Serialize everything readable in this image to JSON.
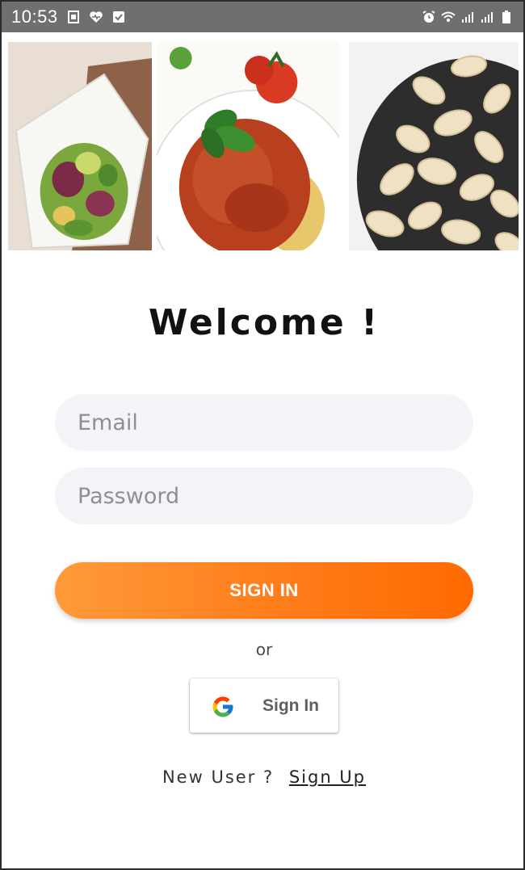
{
  "status_bar": {
    "time": "10:53",
    "icons": [
      "sim-card-icon",
      "heart-icon",
      "checkbox-icon",
      "alarm-icon",
      "wifi-icon",
      "signal-icon",
      "signal-icon",
      "battery-icon"
    ]
  },
  "banner": {
    "images": [
      "salad-image",
      "pasta-bolognese-image",
      "cashews-image"
    ]
  },
  "welcome_title": "Welcome !",
  "form": {
    "email_placeholder": "Email",
    "password_placeholder": "Password",
    "sign_in_label": "SIGN IN",
    "or_text": "or",
    "google_sign_in_label": "Sign In"
  },
  "footer": {
    "prompt": "New User ?",
    "sign_up_label": "Sign Up"
  },
  "colors": {
    "accent_start": "#ff9a3a",
    "accent_end": "#ff6a00",
    "field_bg": "#f3f4f8",
    "status_bar_bg": "#6f6f6f"
  }
}
